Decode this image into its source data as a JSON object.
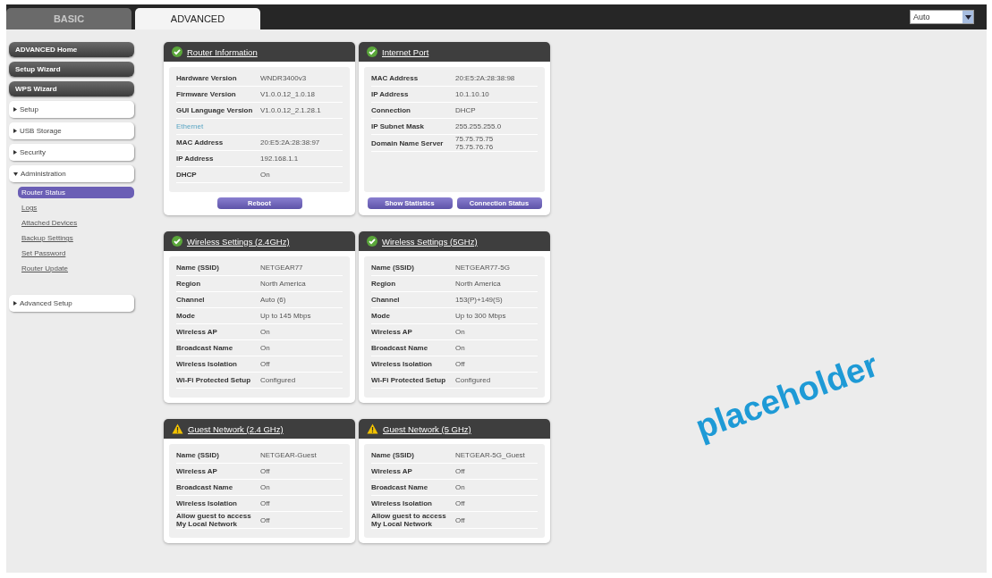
{
  "tabs": [
    {
      "label": "BASIC",
      "selected": false
    },
    {
      "label": "ADVANCED",
      "selected": true
    }
  ],
  "language_select": {
    "value": "Auto"
  },
  "sidebar": {
    "items": [
      {
        "kind": "dark",
        "label": "ADVANCED Home"
      },
      {
        "kind": "dark",
        "label": "Setup Wizard"
      },
      {
        "kind": "dark",
        "label": "WPS Wizard"
      },
      {
        "kind": "section",
        "label": "Setup",
        "expanded": false
      },
      {
        "kind": "section",
        "label": "USB Storage",
        "expanded": false
      },
      {
        "kind": "section",
        "label": "Security",
        "expanded": false
      },
      {
        "kind": "section",
        "label": "Administration",
        "expanded": true,
        "children": [
          {
            "label": "Router Status",
            "selected": true
          },
          {
            "label": "Logs",
            "selected": false
          },
          {
            "label": "Attached Devices",
            "selected": false
          },
          {
            "label": "Backup Settings",
            "selected": false
          },
          {
            "label": "Set Password",
            "selected": false
          },
          {
            "label": "Router Update",
            "selected": false
          }
        ]
      },
      {
        "kind": "section",
        "label": "Advanced Setup",
        "expanded": false
      }
    ]
  },
  "panels": [
    {
      "title": "Router Information",
      "kind": "ok",
      "rows": [
        {
          "kind": "row",
          "label": "Hardware Version",
          "value": "WNDR3400v3"
        },
        {
          "kind": "row",
          "label": "Firmware Version",
          "value": "V1.0.0.12_1.0.18"
        },
        {
          "kind": "row",
          "label": "GUI Language Version",
          "value": "V1.0.0.12_2.1.28.1"
        },
        {
          "kind": "heading",
          "label": "Ethernet"
        },
        {
          "kind": "row",
          "label": "MAC Address",
          "value": "20:E5:2A:28:38:97"
        },
        {
          "kind": "row",
          "label": "IP Address",
          "value": "192.168.1.1"
        },
        {
          "kind": "row",
          "label": "DHCP",
          "value": "On"
        }
      ],
      "buttons": [
        "Reboot"
      ]
    },
    {
      "title": "Internet Port",
      "kind": "ok",
      "rows": [
        {
          "kind": "row",
          "label": "MAC Address",
          "value": "20:E5:2A:28:38:98"
        },
        {
          "kind": "row",
          "label": "IP Address",
          "value": "10.1.10.10"
        },
        {
          "kind": "row",
          "label": "Connection",
          "value": "DHCP"
        },
        {
          "kind": "row",
          "label": "IP Subnet Mask",
          "value": "255.255.255.0"
        },
        {
          "kind": "row",
          "label": "Domain Name Server",
          "value": "75.75.75.75\n75.75.76.76"
        }
      ],
      "buttons": [
        "Show Statistics",
        "Connection Status"
      ]
    },
    {
      "title": "Wireless Settings (2.4GHz)",
      "kind": "ok",
      "rows": [
        {
          "kind": "row",
          "label": "Name (SSID)",
          "value": "NETGEAR77"
        },
        {
          "kind": "row",
          "label": "Region",
          "value": "North America"
        },
        {
          "kind": "row",
          "label": "Channel",
          "value": "Auto (6)"
        },
        {
          "kind": "row",
          "label": "Mode",
          "value": "Up to 145 Mbps"
        },
        {
          "kind": "row",
          "label": "Wireless AP",
          "value": "On"
        },
        {
          "kind": "row",
          "label": "Broadcast Name",
          "value": "On"
        },
        {
          "kind": "row",
          "label": "Wireless Isolation",
          "value": "Off"
        },
        {
          "kind": "row",
          "label": "Wi-Fi Protected Setup",
          "value": "Configured"
        }
      ]
    },
    {
      "title": "Wireless Settings (5GHz)",
      "kind": "ok",
      "rows": [
        {
          "kind": "row",
          "label": "Name (SSID)",
          "value": "NETGEAR77-5G"
        },
        {
          "kind": "row",
          "label": "Region",
          "value": "North America"
        },
        {
          "kind": "row",
          "label": "Channel",
          "value": "153(P)+149(S)"
        },
        {
          "kind": "row",
          "label": "Mode",
          "value": "Up to 300 Mbps"
        },
        {
          "kind": "row",
          "label": "Wireless AP",
          "value": "On"
        },
        {
          "kind": "row",
          "label": "Broadcast Name",
          "value": "On"
        },
        {
          "kind": "row",
          "label": "Wireless Isolation",
          "value": "Off"
        },
        {
          "kind": "row",
          "label": "Wi-Fi Protected Setup",
          "value": "Configured"
        }
      ]
    },
    {
      "title": "Guest Network (2.4 GHz)",
      "kind": "warning",
      "rows": [
        {
          "kind": "row",
          "label": "Name (SSID)",
          "value": "NETGEAR-Guest"
        },
        {
          "kind": "row",
          "label": "Wireless AP",
          "value": "Off"
        },
        {
          "kind": "row",
          "label": "Broadcast Name",
          "value": "On"
        },
        {
          "kind": "row",
          "label": "Wireless Isolation",
          "value": "Off"
        },
        {
          "kind": "row",
          "label": "Allow guest to access\nMy Local Network",
          "value": "Off"
        }
      ]
    },
    {
      "title": "Guest Network (5 GHz)",
      "kind": "warning",
      "rows": [
        {
          "kind": "row",
          "label": "Name (SSID)",
          "value": "NETGEAR-5G_Guest"
        },
        {
          "kind": "row",
          "label": "Wireless AP",
          "value": "Off"
        },
        {
          "kind": "row",
          "label": "Broadcast Name",
          "value": "On"
        },
        {
          "kind": "row",
          "label": "Wireless Isolation",
          "value": "Off"
        },
        {
          "kind": "row",
          "label": "Allow guest to access\nMy Local Network",
          "value": "Off"
        }
      ]
    }
  ],
  "overlay_text": "placeholder"
}
